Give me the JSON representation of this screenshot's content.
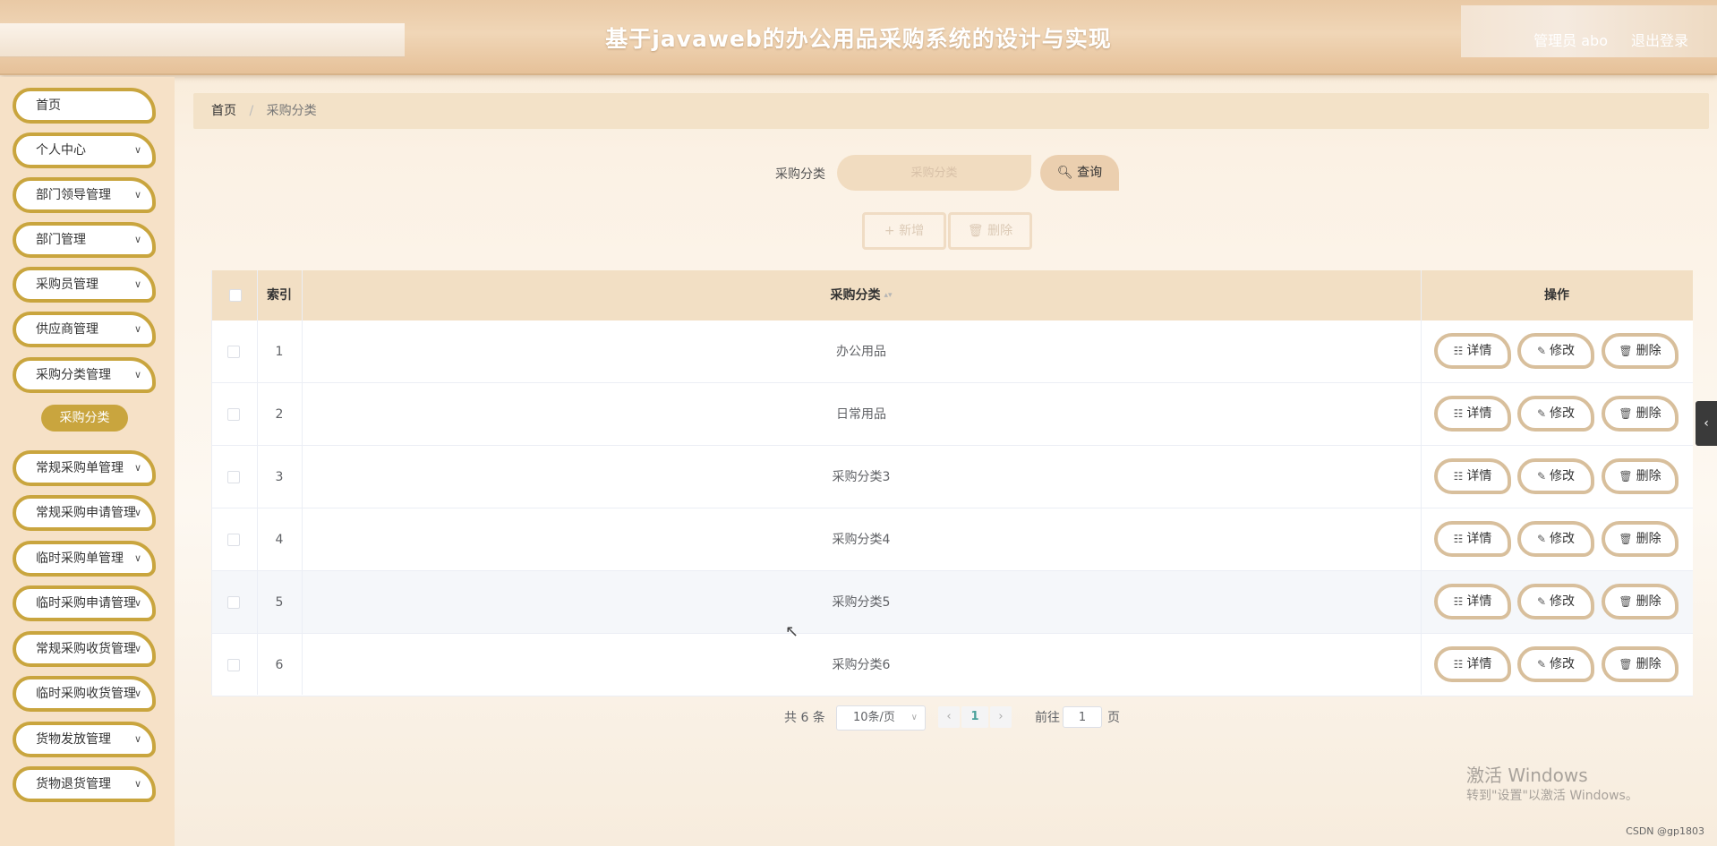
{
  "header": {
    "title": "基于javaweb的办公用品采购系统的设计与实现",
    "user": "管理员 abo",
    "logout": "退出登录"
  },
  "sidebar": {
    "items": [
      {
        "label": "首页",
        "has_arrow": false
      },
      {
        "label": "个人中心",
        "has_arrow": true
      },
      {
        "label": "部门领导管理",
        "has_arrow": true
      },
      {
        "label": "部门管理",
        "has_arrow": true
      },
      {
        "label": "采购员管理",
        "has_arrow": true
      },
      {
        "label": "供应商管理",
        "has_arrow": true
      },
      {
        "label": "采购分类管理",
        "has_arrow": true
      },
      {
        "label": "常规采购单管理",
        "has_arrow": true
      },
      {
        "label": "常规采购申请管理",
        "has_arrow": true
      },
      {
        "label": "临时采购单管理",
        "has_arrow": true
      },
      {
        "label": "临时采购申请管理",
        "has_arrow": true
      },
      {
        "label": "常规采购收货管理",
        "has_arrow": true
      },
      {
        "label": "临时采购收货管理",
        "has_arrow": true
      },
      {
        "label": "货物发放管理",
        "has_arrow": true
      },
      {
        "label": "货物退货管理",
        "has_arrow": true
      }
    ],
    "active_submenu": "采购分类"
  },
  "breadcrumb": {
    "home": "首页",
    "separator": "/",
    "current": "采购分类"
  },
  "search": {
    "label": "采购分类",
    "placeholder": "采购分类",
    "button": "查询",
    "button_icon": "search-icon"
  },
  "actions": {
    "add": "新增",
    "add_icon": "plus-icon",
    "delete": "删除",
    "delete_icon": "trash-icon"
  },
  "table": {
    "columns": [
      "索引",
      "采购分类",
      "操作"
    ],
    "rows": [
      {
        "index": "1",
        "category": "办公用品"
      },
      {
        "index": "2",
        "category": "日常用品"
      },
      {
        "index": "3",
        "category": "采购分类3"
      },
      {
        "index": "4",
        "category": "采购分类4"
      },
      {
        "index": "5",
        "category": "采购分类5"
      },
      {
        "index": "6",
        "category": "采购分类6"
      }
    ],
    "row_buttons": {
      "detail": "详情",
      "edit": "修改",
      "delete": "删除"
    }
  },
  "pagination": {
    "total": "共 6 条",
    "page_size": "10条/页",
    "current_page": "1",
    "goto_prefix": "前往",
    "goto_value": "1",
    "goto_suffix": "页"
  },
  "watermark": {
    "title": "激活 Windows",
    "subtitle": "转到\"设置\"以激活 Windows。"
  },
  "footer_credit": "CSDN @gp1803",
  "colors": {
    "accent_gold": "#c9a53e",
    "header_bg": "#e9c9a5",
    "table_header_bg": "#f2dfc4",
    "button_border": "#d8bf9c",
    "page_active": "#4aa19a"
  }
}
